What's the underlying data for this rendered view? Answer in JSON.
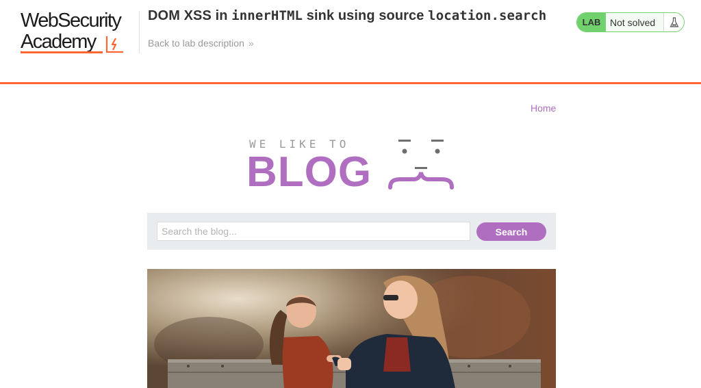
{
  "academy": {
    "logo_line1": "WebSecurity",
    "logo_line2": "Academy",
    "lab_title_prefix": "DOM XSS in ",
    "lab_title_code1": "innerHTML",
    "lab_title_mid": " sink using source ",
    "lab_title_code2": "location.search",
    "back_link": "Back to lab description",
    "status": {
      "badge": "LAB",
      "text": "Not solved",
      "icon": "flask-icon"
    },
    "accent_color": "#ff6633",
    "status_color": "#70d16d"
  },
  "blog": {
    "nav_home": "Home",
    "banner_tagline": "WE LIKE TO",
    "banner_title": "BLOG",
    "accent_color": "#b06ec0",
    "search": {
      "placeholder": "Search the blog...",
      "value": "",
      "button": "Search"
    }
  }
}
